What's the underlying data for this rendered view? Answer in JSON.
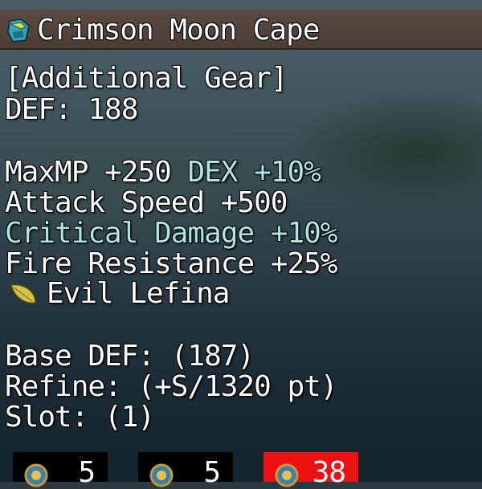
{
  "item": {
    "name": "Crimson Moon Cape",
    "icon": "cape-icon"
  },
  "stats": {
    "category": "[Additional Gear]",
    "def": "DEF: 188",
    "maxmp": "MaxMP +250",
    "dex": "DEX +10%",
    "attack_speed": "Attack Speed +500",
    "crit_damage": "Critical Damage +10%",
    "fire_resist": "Fire Resistance +25%",
    "card_name": "Evil Lefina",
    "card_icon": "leaf-card-icon",
    "base_def": "Base DEF: (187)",
    "refine": "Refine: (+S/1320 pt)",
    "slot": "Slot: (1)"
  },
  "colors": {
    "highlight": "#aee6e6",
    "title_bar": "#4a3c35",
    "alert_box": "#ee1111"
  },
  "bottom_slots": [
    {
      "icon": "coin-medallion-icon",
      "count": "5"
    },
    {
      "icon": "coin-medallion-icon",
      "count": "5"
    },
    {
      "icon": "coin-medallion-icon",
      "count": "38"
    }
  ]
}
